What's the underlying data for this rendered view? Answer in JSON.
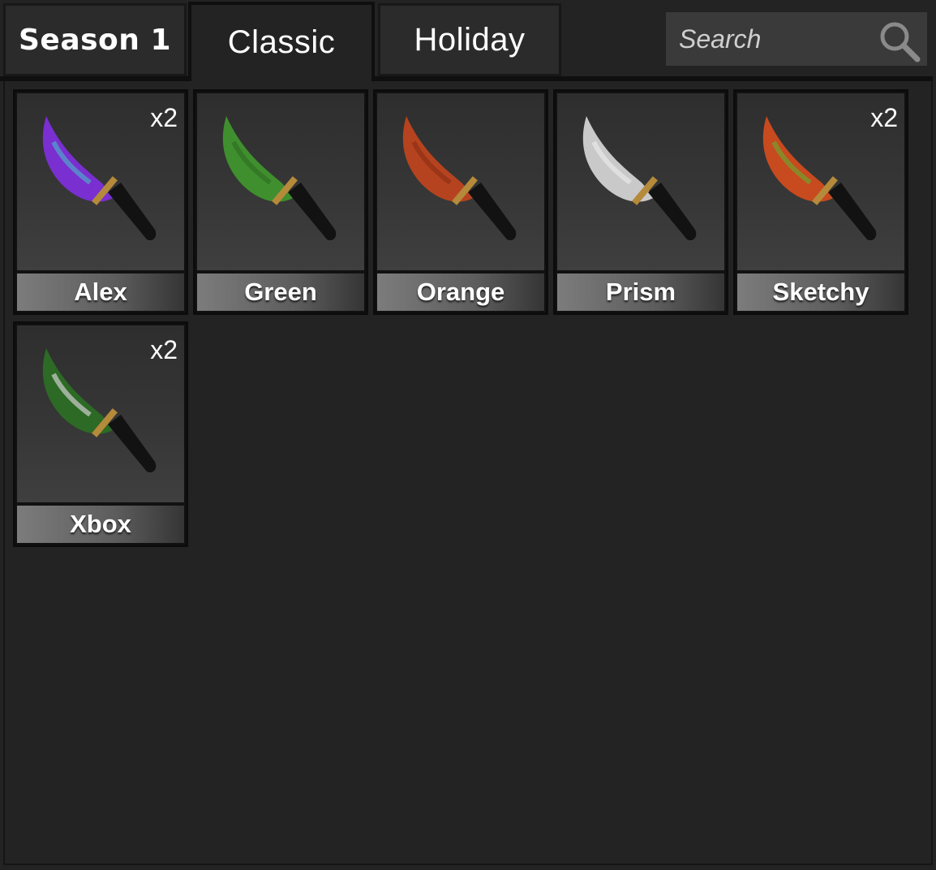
{
  "tabs": [
    {
      "label": "Season 1"
    },
    {
      "label": "Classic"
    },
    {
      "label": "Holiday"
    }
  ],
  "search": {
    "placeholder": "Search"
  },
  "items": [
    {
      "name": "Alex",
      "count": "x2",
      "blade": "#7a2fd0",
      "accent": "#4fa7c9"
    },
    {
      "name": "Green",
      "count": "",
      "blade": "#3f8f2e",
      "accent": "#2f6f24"
    },
    {
      "name": "Orange",
      "count": "",
      "blade": "#b6431f",
      "accent": "#8f2f16"
    },
    {
      "name": "Prism",
      "count": "",
      "blade": "#c9c9c9",
      "accent": "#e8e8e8"
    },
    {
      "name": "Sketchy",
      "count": "x2",
      "blade": "#c84a1f",
      "accent": "#6ea22e"
    },
    {
      "name": "Xbox",
      "count": "x2",
      "blade": "#2c6a25",
      "accent": "#cfcfcf"
    }
  ]
}
